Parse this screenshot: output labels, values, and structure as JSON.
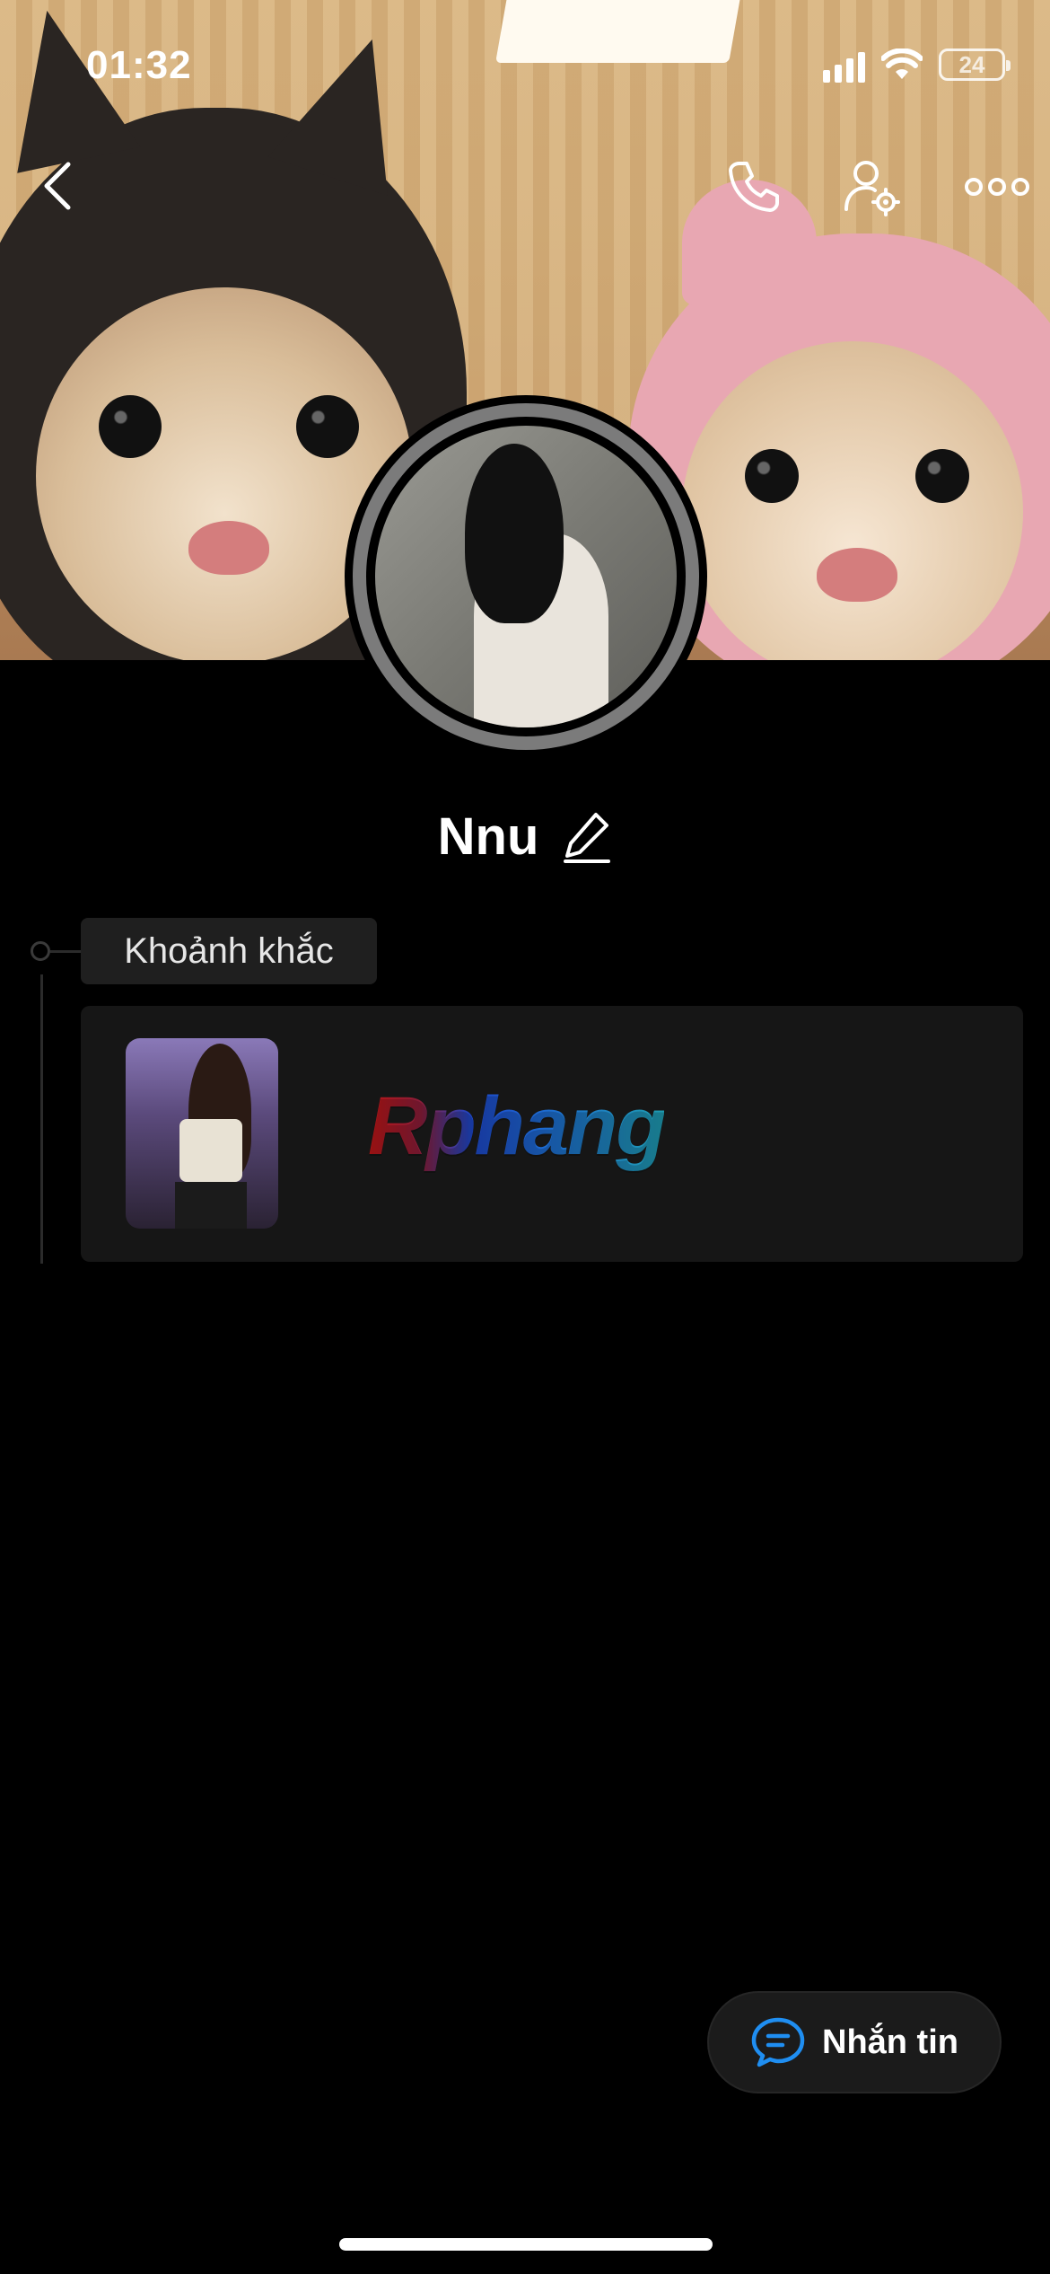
{
  "status_bar": {
    "time": "01:32",
    "battery_level": "24",
    "icons": [
      "cellular-signal-icon",
      "wifi-icon",
      "battery-icon"
    ]
  },
  "top_nav": {
    "icons": [
      "back-chevron-icon",
      "phone-call-icon",
      "user-settings-icon",
      "more-options-icon"
    ]
  },
  "profile": {
    "name": "Nnu",
    "edit_icon": "pencil-edit-icon"
  },
  "moments": {
    "section_label": "Khoảnh khắc",
    "watermark_text": "Rphang"
  },
  "actions": {
    "message_label": "Nhắn tin",
    "message_icon": "chat-bubble-icon"
  },
  "colors": {
    "background": "#000000",
    "card": "#161616",
    "chip": "#1f1f1f",
    "accent_blue": "#1f8ef1"
  }
}
